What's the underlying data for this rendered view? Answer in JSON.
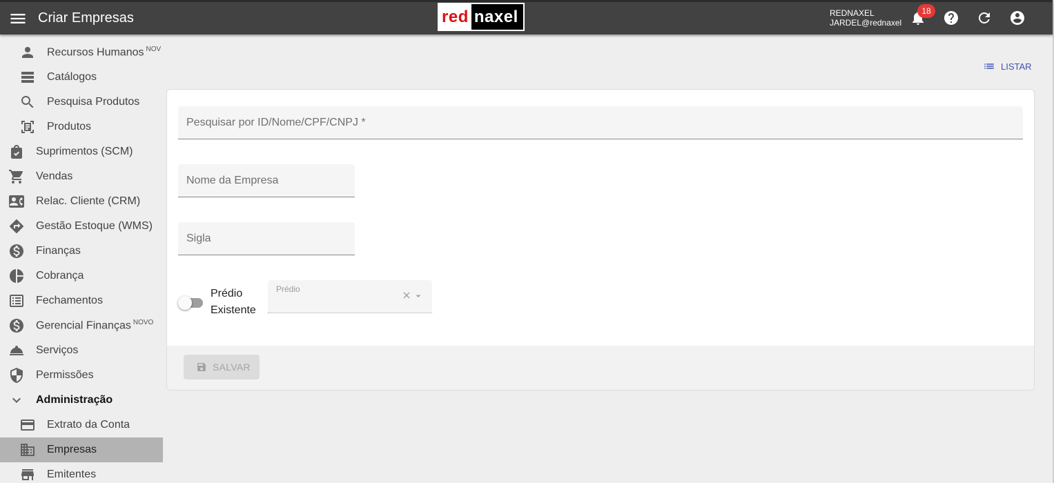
{
  "header": {
    "title": "Criar Empresas",
    "logo_red": "red",
    "logo_rest": "naxel",
    "user_company": "REDNAXEL",
    "user_email": "JARDEL@rednaxel",
    "notification_count": "18"
  },
  "sidebar": {
    "items": [
      {
        "label": "Recursos Humanos",
        "sup": "NOV",
        "icon": "person-icon"
      },
      {
        "label": "Catálogos",
        "icon": "list-icon"
      },
      {
        "label": "Pesquisa Produtos",
        "icon": "search-icon"
      },
      {
        "label": "Produtos",
        "icon": "document-scanner-icon"
      },
      {
        "label": "Suprimentos (SCM)",
        "icon": "shopping-bag-icon"
      },
      {
        "label": "Vendas",
        "icon": "cart-icon"
      },
      {
        "label": "Relac. Cliente (CRM)",
        "icon": "contact-card-icon"
      },
      {
        "label": "Gestão Estoque (WMS)",
        "icon": "directions-icon"
      },
      {
        "label": "Finanças",
        "icon": "dollar-icon"
      },
      {
        "label": "Cobrança",
        "icon": "pie-chart-icon"
      },
      {
        "label": "Fechamentos",
        "icon": "receipt-list-icon"
      },
      {
        "label": "Gerencial Finanças",
        "sup": "NOVO",
        "icon": "dollar-icon"
      },
      {
        "label": "Serviços",
        "icon": "room-service-icon"
      },
      {
        "label": "Permissões",
        "icon": "shield-icon"
      },
      {
        "label": "Administração",
        "icon": "chevron-down-icon"
      },
      {
        "label": "Extrato da Conta",
        "icon": "credit-card-icon"
      },
      {
        "label": "Empresas",
        "icon": "building-icon"
      },
      {
        "label": "Emitentes",
        "icon": "store-icon"
      }
    ]
  },
  "main": {
    "list_label": "LISTAR",
    "search_placeholder": "Pesquisar por ID/Nome/CPF/CNPJ *",
    "company_name_placeholder": "Nome da Empresa",
    "acronym_placeholder": "Sigla",
    "toggle_label": "Prédio Existente",
    "toggle_on": false,
    "building_select_label": "Prédio",
    "save_label": "SALVAR"
  },
  "colors": {
    "header_bg": "#424242",
    "accent": "#3f51b5",
    "badge": "#e53935",
    "active_item_bg": "#b3b3b3"
  }
}
